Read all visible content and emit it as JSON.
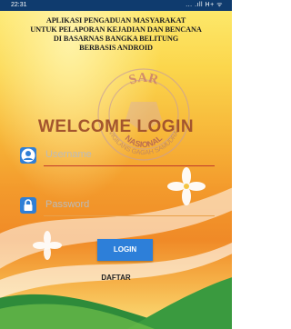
{
  "status_bar": {
    "time": "22:31",
    "system_icons": "... .ıll H+ ᯤ"
  },
  "header": {
    "lines": [
      "APLIKASI PENGADUAN MASYARAKAT",
      "UNTUK PELAPORAN KEJADIAN DAN BENCANA",
      "DI BASARNAS BANGKA BELITUNG",
      "BERBASIS ANDROID"
    ]
  },
  "logo": {
    "top_text": "SAR",
    "ring_text": "NASIONAL",
    "outer_text": "VIGILANS GAGAH SAMUDRA"
  },
  "welcome_text": "WELCOME  LOGIN",
  "form": {
    "username": {
      "placeholder": "Username",
      "icon": "user-icon"
    },
    "password": {
      "placeholder": "Password",
      "icon": "lock-icon"
    }
  },
  "login_button": "LOGIN",
  "register_link": "DAFTAR",
  "colors": {
    "status_bar": "#0f3b6e",
    "accent_blue": "#2d7fd9",
    "welcome": "#a3552e",
    "field_underline": "#c0392b"
  }
}
